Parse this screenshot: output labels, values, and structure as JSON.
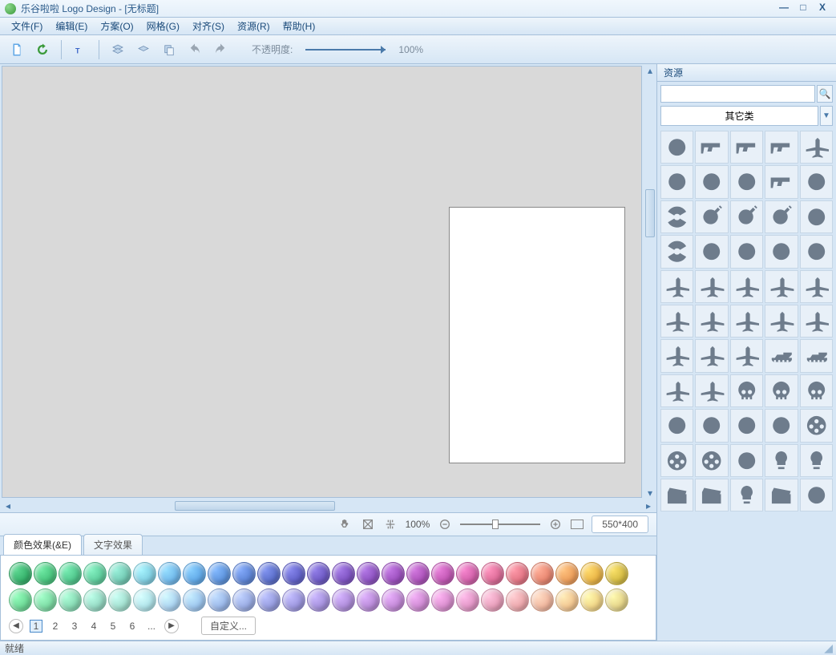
{
  "window": {
    "title": "乐谷啦啦 Logo Design - [无标题]",
    "min": "—",
    "max": "□",
    "close": "X"
  },
  "menu": {
    "file": "文件(F)",
    "edit": "编辑(E)",
    "plan": "方案(O)",
    "grid": "网格(G)",
    "align": "对齐(S)",
    "resource": "资源(R)",
    "help": "帮助(H)"
  },
  "toolbar": {
    "opacity_label": "不透明度:",
    "opacity_value": "100%"
  },
  "zoom": {
    "percent": "100%",
    "size": "550*400"
  },
  "tabs": {
    "color": "颜色效果(&E)",
    "text": "文字效果"
  },
  "pager": {
    "p1": "1",
    "p2": "2",
    "p3": "3",
    "p4": "4",
    "p5": "5",
    "p6": "6",
    "dots": "...",
    "custom": "自定义..."
  },
  "colors_row1": [
    "#35b06a",
    "#47c27c",
    "#4fc58b",
    "#5dcb9b",
    "#72c9b3",
    "#7fcde0",
    "#6fb7ea",
    "#5fa7e6",
    "#5c92db",
    "#5c83d4",
    "#5a6dc9",
    "#6060c7",
    "#6c58c2",
    "#7d52c0",
    "#8c51bf",
    "#9b4fbd",
    "#ab51b8",
    "#c056b2",
    "#d05fa8",
    "#db6a96",
    "#e27383",
    "#e8856f",
    "#eb9c59",
    "#e9b344",
    "#d3ba42"
  ],
  "colors_row2": [
    "#6bd694",
    "#7bd9a2",
    "#85d7b1",
    "#93d7c1",
    "#a0ddcc",
    "#aee2e8",
    "#a9d1f0",
    "#9bc4ed",
    "#98b5e7",
    "#97a9e1",
    "#9399db",
    "#9a94dc",
    "#a28ed9",
    "#ac8ad7",
    "#b688d5",
    "#c086d4",
    "#cb87cf",
    "#d68bcb",
    "#df93c3",
    "#e59bb7",
    "#eaa4a9",
    "#efb49c",
    "#f1c48f",
    "#efd285",
    "#e3d287"
  ],
  "sidebar": {
    "title": "资源",
    "search_placeholder": "",
    "category": "其它类"
  },
  "resource_icons": [
    "shuriken-icon",
    "pistol-icon",
    "revolver-icon",
    "handgun-icon",
    "rocket-icon",
    "knife-icon",
    "bullet-icon",
    "shell-icon",
    "uzi-icon",
    "crosshair-icon",
    "radiation-icon",
    "bomb-icon",
    "bomb2-icon",
    "grenade-icon",
    "spray-icon",
    "biohazard-icon",
    "lasso-icon",
    "jerrycan-icon",
    "horn-icon",
    "sanitizer-icon",
    "plane-icon",
    "plane2-icon",
    "plane3-icon",
    "jet-icon",
    "glider-icon",
    "biplane-icon",
    "fighter-icon",
    "fighter2-icon",
    "fighter3-icon",
    "missile-icon",
    "chopper-icon",
    "chopper2-icon",
    "drone-icon",
    "tank-icon",
    "ship-icon",
    "prop-icon",
    "jet2-icon",
    "skull-icon",
    "skull2-icon",
    "crossbones-icon",
    "vr-icon",
    "head-icon",
    "telescope-icon",
    "radar-icon",
    "reel-icon",
    "reel2-icon",
    "reel3-icon",
    "burst-icon",
    "bulb-icon",
    "balloon-icon",
    "clapper-icon",
    "clapper2-icon",
    "light-icon",
    "screen-icon",
    "tripod-icon"
  ],
  "status": {
    "ready": "就绪"
  }
}
